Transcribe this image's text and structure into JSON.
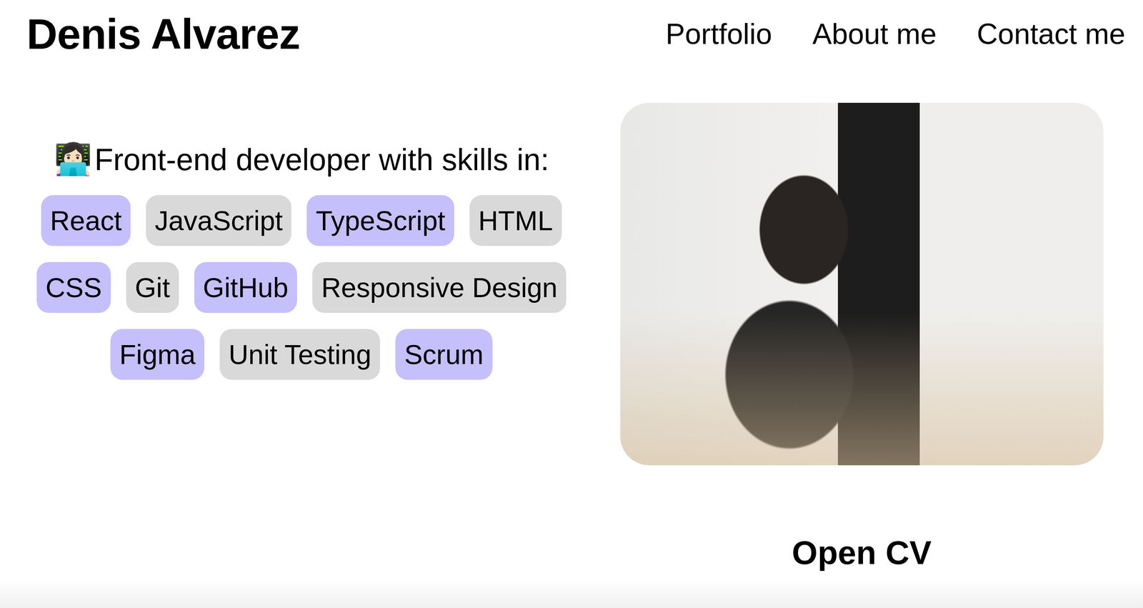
{
  "header": {
    "title": "Denis Alvarez"
  },
  "nav": [
    "Portfolio",
    "About me",
    "Contact me"
  ],
  "intro": {
    "emoji": "👩🏻‍💻",
    "text": "Front-end developer with skills in:"
  },
  "skills": [
    {
      "label": "React",
      "color": "#c5bffc"
    },
    {
      "label": "JavaScript",
      "color": "#d9d9d9"
    },
    {
      "label": "TypeScript",
      "color": "#c5bffc"
    },
    {
      "label": "HTML",
      "color": "#d9d9d9"
    },
    {
      "label": "CSS",
      "color": "#c5bffc"
    },
    {
      "label": "Git",
      "color": "#d9d9d9"
    },
    {
      "label": "GitHub",
      "color": "#c5bffc"
    },
    {
      "label": "Responsive Design",
      "color": "#d9d9d9"
    },
    {
      "label": "Figma",
      "color": "#c5bffc"
    },
    {
      "label": "Unit Testing",
      "color": "#d9d9d9"
    },
    {
      "label": "Scrum",
      "color": "#c5bffc"
    }
  ],
  "cv_button": "Open CV"
}
